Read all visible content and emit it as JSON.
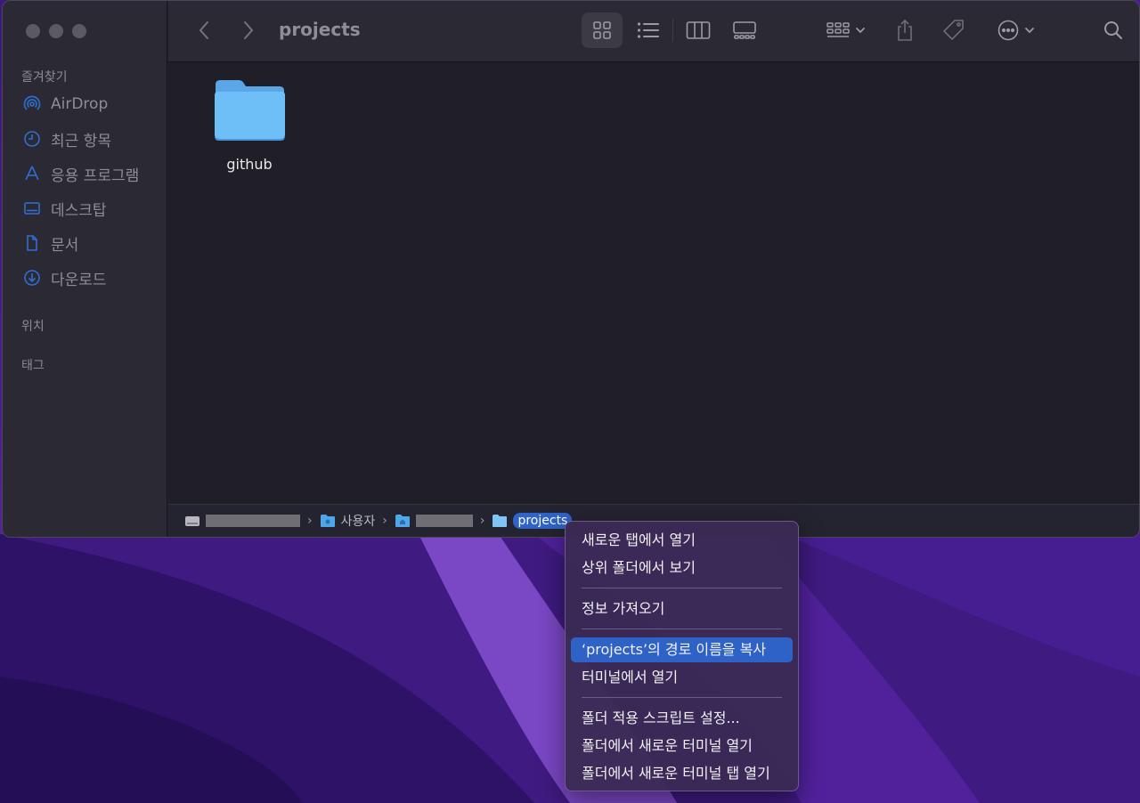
{
  "window": {
    "title": "projects"
  },
  "sidebar": {
    "favorites_header": "즐겨찾기",
    "items": [
      {
        "label": "AirDrop",
        "icon": "airdrop-icon"
      },
      {
        "label": "최근 항목",
        "icon": "clock-icon"
      },
      {
        "label": "응용 프로그램",
        "icon": "applications-icon"
      },
      {
        "label": "데스크탑",
        "icon": "desktop-icon"
      },
      {
        "label": "문서",
        "icon": "document-icon"
      },
      {
        "label": "다운로드",
        "icon": "download-icon"
      }
    ],
    "locations_header": "위치",
    "tags_header": "태그"
  },
  "content": {
    "items": [
      {
        "name": "github",
        "kind": "folder"
      }
    ]
  },
  "pathbar": {
    "crumbs": [
      {
        "label": "",
        "icon": "disk-icon",
        "redacted": true
      },
      {
        "label": "사용자",
        "icon": "folder-icon",
        "redacted": false
      },
      {
        "label": "",
        "icon": "home-folder-icon",
        "redacted": true
      },
      {
        "label": "projects",
        "icon": "folder-icon",
        "redacted": false,
        "selected": true
      }
    ]
  },
  "context_menu": {
    "items": [
      {
        "label": "새로운 탭에서 열기"
      },
      {
        "label": "상위 폴더에서 보기"
      },
      {
        "label": "정보 가져오기"
      },
      {
        "label": "‘projects’의 경로 이름을 복사",
        "highlighted": true
      },
      {
        "label": "터미널에서 열기"
      },
      {
        "label": "폴더 적용 스크립트 설정..."
      },
      {
        "label": "폴더에서 새로운 터미널 열기"
      },
      {
        "label": "폴더에서 새로운 터미널 탭 열기"
      }
    ]
  },
  "colors": {
    "accent": "#2e62c6",
    "folder": "#6ab9f2"
  }
}
